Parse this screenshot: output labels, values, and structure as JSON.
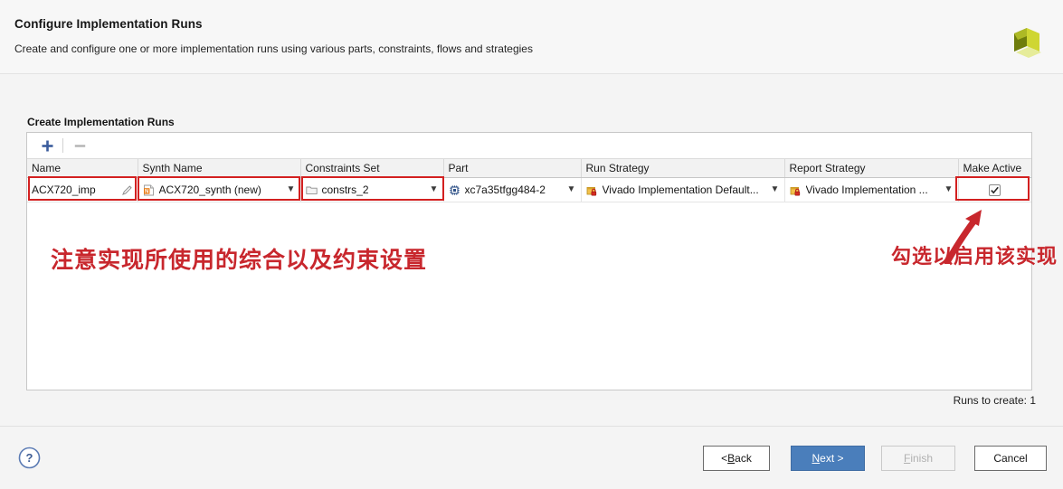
{
  "header": {
    "title": "Configure Implementation Runs",
    "subtitle": "Create and configure one or more implementation runs using various parts, constraints, flows and strategies",
    "logo_icon": "xilinx-logo",
    "logo_colors": [
      "#c9d12a",
      "#7e8a10",
      "#e3ea8d"
    ]
  },
  "section": {
    "label": "Create Implementation Runs"
  },
  "toolbar": {
    "add_icon": "plus-icon",
    "add_color": "#3a5b9c",
    "remove_icon": "minus-icon",
    "remove_color": "#b0b0b0"
  },
  "table": {
    "columns": [
      {
        "key": "name",
        "label": "Name"
      },
      {
        "key": "synth_name",
        "label": "Synth Name"
      },
      {
        "key": "constraints_set",
        "label": "Constraints Set"
      },
      {
        "key": "part",
        "label": "Part"
      },
      {
        "key": "run_strategy",
        "label": "Run Strategy"
      },
      {
        "key": "report_strategy",
        "label": "Report Strategy"
      },
      {
        "key": "make_active",
        "label": "Make Active"
      }
    ],
    "rows": [
      {
        "name": "ACX720_imp",
        "name_icon": "pencil-icon",
        "synth_name": "ACX720_synth (new)",
        "synth_icon": "synth-run-icon",
        "constraints_set": "constrs_2",
        "constraints_icon": "folder-icon",
        "part": "xc7a35tfgg484-2",
        "part_icon": "chip-icon",
        "run_strategy": "Vivado Implementation Default...",
        "run_strategy_icon": "strategy-lock-icon",
        "report_strategy": "Vivado Implementation ...",
        "report_strategy_icon": "strategy-lock-icon",
        "make_active": true,
        "make_active_icon": "checkmark-icon"
      }
    ],
    "dropdown_icon": "chevron-down-icon"
  },
  "footer": {
    "runs_to_create": "Runs to create: 1"
  },
  "annotations": {
    "highlight_color": "#d32020",
    "text_color": "#c8272d",
    "left_note": "注意实现所使用的综合以及约束设置",
    "right_note": "勾选以启用该实现",
    "arrow_icon": "arrow-up-right-icon"
  },
  "buttons": {
    "help_icon": "question-mark-icon",
    "help_color": "#5b7bb4",
    "back": {
      "prefix": "< ",
      "mnemonic": "B",
      "rest": "ack"
    },
    "next": {
      "prefix": "",
      "mnemonic": "N",
      "rest": "ext >",
      "accent": "#4a7ebb"
    },
    "finish": {
      "prefix": "",
      "mnemonic": "F",
      "rest": "inish",
      "disabled": true
    },
    "cancel": {
      "label": "Cancel"
    }
  }
}
